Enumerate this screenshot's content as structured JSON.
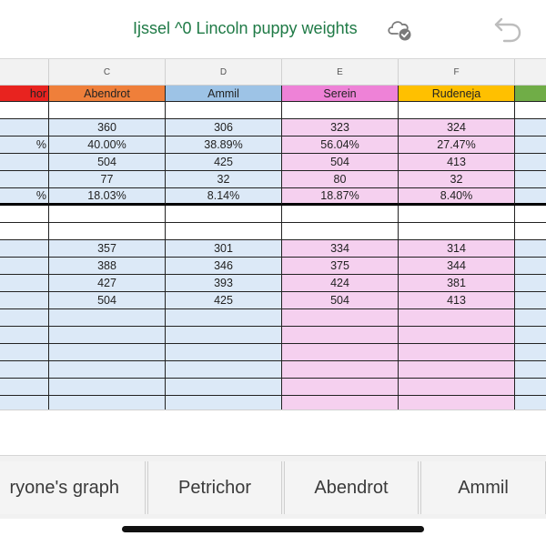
{
  "title": {
    "text": "Ijssel ^0 Lincoln puppy weights",
    "cloud_icon": "cloud-check-icon",
    "undo_icon": "undo-icon"
  },
  "column_letters": [
    "",
    "C",
    "D",
    "E",
    "F",
    ""
  ],
  "headers": [
    "hor",
    "Abendrot",
    "Ammil",
    "Serein",
    "Rudeneja",
    ""
  ],
  "header_colors": [
    "#e8231f",
    "#ef7f3a",
    "#9dc3e6",
    "#ee82d7",
    "#ffc000",
    "#70ad47"
  ],
  "body_colors": [
    "#dce9f7",
    "#dce9f7",
    "#dce9f7",
    "#f5d0ef",
    "#f5d0ef",
    "#dce9f7"
  ],
  "section1": [
    [
      "",
      "360",
      "306",
      "323",
      "324",
      ""
    ],
    [
      "%",
      "40.00%",
      "38.89%",
      "56.04%",
      "27.47%",
      ""
    ],
    [
      "",
      "504",
      "425",
      "504",
      "413",
      ""
    ],
    [
      "",
      "77",
      "32",
      "80",
      "32",
      ""
    ],
    [
      "%",
      "18.03%",
      "8.14%",
      "18.87%",
      "8.40%",
      ""
    ]
  ],
  "section2": [
    [
      "",
      "357",
      "301",
      "334",
      "314",
      ""
    ],
    [
      "",
      "388",
      "346",
      "375",
      "344",
      ""
    ],
    [
      "",
      "427",
      "393",
      "424",
      "381",
      ""
    ],
    [
      "",
      "504",
      "425",
      "504",
      "413",
      ""
    ],
    [
      "",
      "",
      "",
      "",
      "",
      ""
    ],
    [
      "",
      "",
      "",
      "",
      "",
      ""
    ],
    [
      "",
      "",
      "",
      "",
      "",
      ""
    ],
    [
      "",
      "",
      "",
      "",
      "",
      ""
    ],
    [
      "",
      "",
      "",
      "",
      "",
      ""
    ],
    [
      "",
      "",
      "",
      "",
      "",
      ""
    ]
  ],
  "tabs": [
    "ryone's graph",
    "Petrichor",
    "Abendrot",
    "Ammil"
  ]
}
